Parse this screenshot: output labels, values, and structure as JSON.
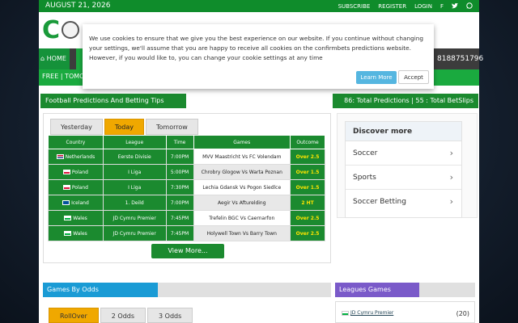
{
  "topbar": {
    "date": "AUGUST 21, 2026",
    "subscribe": "SUBSCRIBE",
    "register": "REGISTER",
    "login": "LOGIN",
    "social": [
      "f",
      "t",
      "w"
    ]
  },
  "nav": {
    "home": "HOME",
    "phone": "8188751796",
    "subnav": "FREE  | TOMO"
  },
  "sections": {
    "predictions_title": "Football Predictions And Betting Tips",
    "totals": "86: Total Predictions | 55 : Total BetSlips"
  },
  "tabs": [
    "Yesterday",
    "Today",
    "Tomorrow"
  ],
  "table": {
    "headers": [
      "Country",
      "League",
      "Time",
      "Games",
      "Outcome"
    ],
    "rows": [
      {
        "country": "Netherlands",
        "league": "Eerste Divisie",
        "time": "7:00PM",
        "game": "MVV Maastricht Vs FC Volendam",
        "outcome": "Over 2.5",
        "flag": "nl"
      },
      {
        "country": "Poland",
        "league": "I Liga",
        "time": "5:00PM",
        "game": "Chrobry Glogow Vs Warta Poznan",
        "outcome": "Over 1.5",
        "flag": "pl"
      },
      {
        "country": "Poland",
        "league": "I Liga",
        "time": "7:30PM",
        "game": "Lechia Gdansk Vs Pogon Siedlce",
        "outcome": "Over 1.5",
        "flag": "pl"
      },
      {
        "country": "Iceland",
        "league": "1. Deild",
        "time": "7:00PM",
        "game": "Aegir Vs Afturelding",
        "outcome": "2 HT",
        "flag": "is"
      },
      {
        "country": "Wales",
        "league": "JD Cymru Premier",
        "time": "7:45PM",
        "game": "Trefelin BGC Vs Caernarfon",
        "outcome": "Over 2.5",
        "flag": "wa"
      },
      {
        "country": "Wales",
        "league": "JD Cymru Premier",
        "time": "7:45PM",
        "game": "Holywell Town Vs Barry Town",
        "outcome": "Over 2.5",
        "flag": "wa"
      }
    ]
  },
  "view_more": "View More...",
  "discover": {
    "title": "Discover more",
    "items": [
      "Soccer",
      "Sports",
      "Soccer Betting"
    ]
  },
  "bottom": {
    "games_by_odds": "Games By Odds",
    "leagues_games": "Leagues Games",
    "odds_tabs": [
      "RollOver",
      "2 Odds",
      "3 Odds"
    ],
    "league_item": "JD Cymru Premier",
    "league_count": "(20)"
  },
  "cookie": {
    "text": "We use cookies to ensure that we give you the best experience on our website. If you continue without changing your settings, we'll assume that you are happy to receive all cookies on the confirmbets predictions website. However, if you would like to, you can change your cookie settings at any time",
    "learn_more": "Learn More",
    "accept": "Accept"
  },
  "colors": {
    "green": "#1b8a2f",
    "accent": "#f0a800",
    "blue": "#1a9bd5",
    "purple": "#7a5ac9"
  }
}
